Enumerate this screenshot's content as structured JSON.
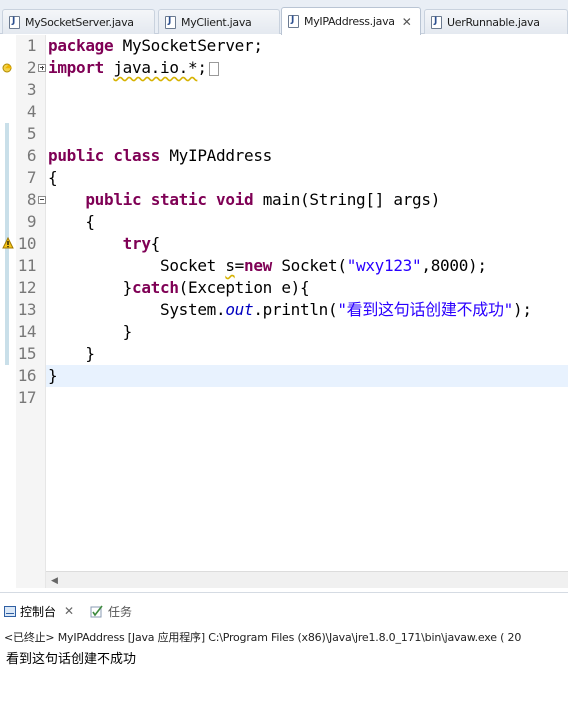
{
  "tabs": [
    {
      "label": "MySocketServer.java",
      "active": false,
      "closable": false
    },
    {
      "label": "MyClient.java",
      "active": false,
      "closable": false
    },
    {
      "label": "MyIPAddress.java",
      "active": true,
      "closable": true,
      "close_glyph": "✕"
    },
    {
      "label": "UerRunnable.java",
      "active": false,
      "closable": false
    }
  ],
  "editor": {
    "line_numbers": [
      "1",
      "2",
      "3",
      "4",
      "5",
      "6",
      "7",
      "8",
      "9",
      "10",
      "11",
      "12",
      "13",
      "14",
      "15",
      "16",
      "17"
    ],
    "code_lines": [
      {
        "n": "1",
        "parts": [
          {
            "t": "package",
            "c": "kw"
          },
          {
            "t": " MySocketServer;"
          }
        ]
      },
      {
        "n": "2",
        "parts": [
          {
            "t": "import",
            "c": "kw"
          },
          {
            "t": " "
          },
          {
            "t": "java.io.*",
            "c": "squig"
          },
          {
            "t": ";"
          }
        ],
        "folded": true
      },
      {
        "n": "3",
        "parts": []
      },
      {
        "n": "4",
        "parts": []
      },
      {
        "n": "5",
        "parts": []
      },
      {
        "n": "6",
        "parts": [
          {
            "t": "public",
            "c": "kw"
          },
          {
            "t": " "
          },
          {
            "t": "class",
            "c": "kw"
          },
          {
            "t": " MyIPAddress"
          }
        ]
      },
      {
        "n": "7",
        "parts": [
          {
            "t": "{"
          }
        ]
      },
      {
        "n": "8",
        "parts": [
          {
            "t": "    "
          },
          {
            "t": "public",
            "c": "kw"
          },
          {
            "t": " "
          },
          {
            "t": "static",
            "c": "kw"
          },
          {
            "t": " "
          },
          {
            "t": "void",
            "c": "kw"
          },
          {
            "t": " main(String[] args)"
          }
        ]
      },
      {
        "n": "9",
        "parts": [
          {
            "t": "    {"
          }
        ]
      },
      {
        "n": "10",
        "parts": [
          {
            "t": "        "
          },
          {
            "t": "try",
            "c": "kw"
          },
          {
            "t": "{"
          }
        ]
      },
      {
        "n": "11",
        "parts": [
          {
            "t": "            Socket "
          },
          {
            "t": "s",
            "c": "squig"
          },
          {
            "t": "="
          },
          {
            "t": "new",
            "c": "kw"
          },
          {
            "t": " Socket("
          },
          {
            "t": "\"wxy123\"",
            "c": "str"
          },
          {
            "t": ",8000);"
          }
        ]
      },
      {
        "n": "12",
        "parts": [
          {
            "t": "        }"
          },
          {
            "t": "catch",
            "c": "kw"
          },
          {
            "t": "(Exception e){"
          }
        ]
      },
      {
        "n": "13",
        "parts": [
          {
            "t": "            System."
          },
          {
            "t": "out",
            "c": "field"
          },
          {
            "t": ".println("
          },
          {
            "t": "\"看到这句话创建不成功\"",
            "c": "str"
          },
          {
            "t": ");"
          }
        ]
      },
      {
        "n": "14",
        "parts": [
          {
            "t": "        }"
          }
        ]
      },
      {
        "n": "15",
        "parts": [
          {
            "t": "    }"
          }
        ]
      },
      {
        "n": "16",
        "parts": [
          {
            "t": "}"
          }
        ]
      },
      {
        "n": "17",
        "parts": []
      }
    ],
    "current_line": "16",
    "warning_lines": [
      "2",
      "11"
    ],
    "scroll_left_glyph": "◀"
  },
  "console": {
    "tabs": [
      {
        "label": "控制台",
        "active": true,
        "close_glyph": "✕"
      },
      {
        "label": "任务",
        "active": false
      }
    ],
    "status": "<已终止> MyIPAddress [Java 应用程序] C:\\Program Files (x86)\\Java\\jre1.8.0_171\\bin\\javaw.exe ( 20",
    "output": "看到这句话创建不成功"
  },
  "colors": {
    "keyword": "#7f0055",
    "string": "#2a00ff",
    "field": "#0000c0",
    "current_line": "#e8f2fe",
    "change_bar": "#c9dfe9"
  }
}
